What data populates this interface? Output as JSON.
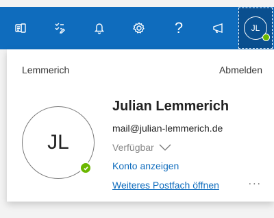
{
  "toolbar": {
    "icons": [
      "office-apps-icon",
      "tasks-icon",
      "bell-icon",
      "settings-icon",
      "help-icon",
      "megaphone-icon"
    ],
    "help_glyph": "?",
    "account_initials": "JL"
  },
  "colors": {
    "brand": "#0f6cbd",
    "presence_available": "#6bb700",
    "link": "#0f6cbd"
  },
  "account_panel": {
    "tenant": "Lemmerich",
    "sign_out": "Abmelden",
    "avatar_initials": "JL",
    "name": "Julian Lemmerich",
    "email": "mail@julian-lemmerich.de",
    "status": "Verfügbar",
    "view_account": "Konto anzeigen",
    "open_another_mailbox": "Weiteres Postfach öffnen",
    "more": "..."
  }
}
